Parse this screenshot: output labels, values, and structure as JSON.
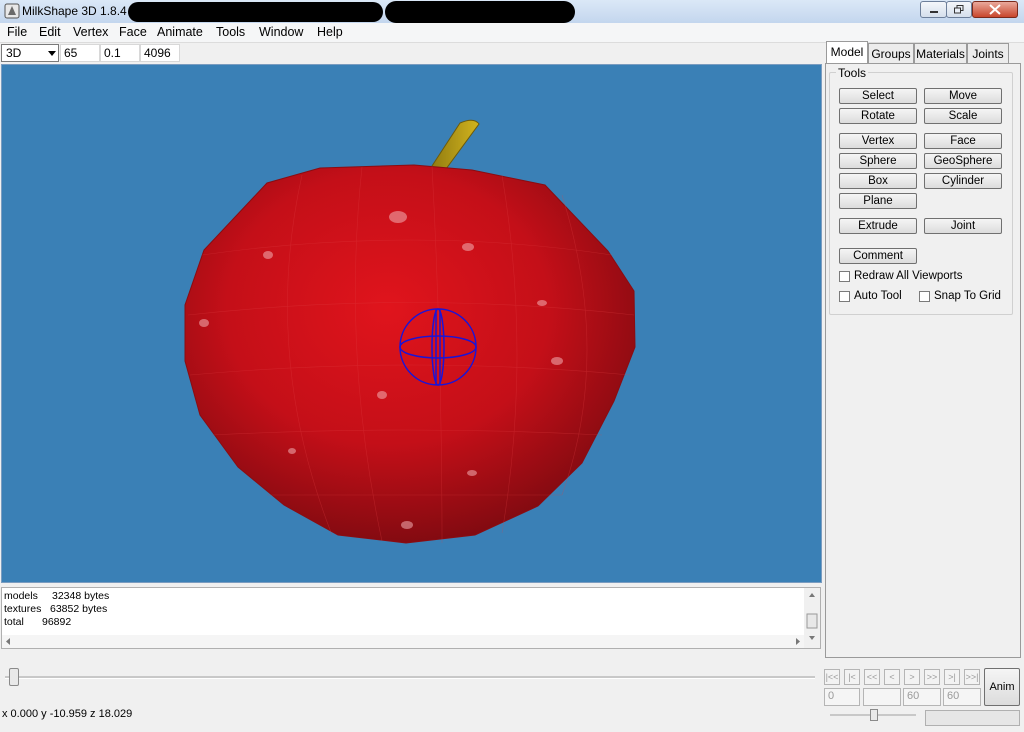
{
  "window": {
    "title": "MilkShape 3D 1.8.4"
  },
  "menu": [
    "File",
    "Edit",
    "Vertex",
    "Face",
    "Animate",
    "Tools",
    "Window",
    "Help"
  ],
  "toolbar": {
    "view_mode": "3D",
    "field1": "65",
    "field2": "0.1",
    "field3": "4096"
  },
  "log": {
    "lines": [
      {
        "label": "models",
        "value": "32348 bytes"
      },
      {
        "label": "textures",
        "value": "63852 bytes"
      },
      {
        "label": "total",
        "value": "96892"
      }
    ]
  },
  "status": {
    "coords": "x 0.000 y -10.959 z 18.029"
  },
  "tabs": [
    "Model",
    "Groups",
    "Materials",
    "Joints"
  ],
  "tools": {
    "group_label": "Tools",
    "buttons": [
      "Select",
      "Move",
      "Rotate",
      "Scale",
      "Vertex",
      "Face",
      "Sphere",
      "GeoSphere",
      "Box",
      "Cylinder",
      "Plane",
      "Extrude",
      "Joint",
      "Comment"
    ],
    "checkboxes": [
      "Redraw All Viewports",
      "Auto Tool",
      "Snap To Grid"
    ]
  },
  "animation": {
    "buttons": [
      "|<<",
      "|<",
      "<<",
      "<",
      ">",
      ">>",
      ">|",
      ">>|"
    ],
    "frame": "0",
    "blank": "",
    "start": "60",
    "end": "60",
    "anim_label": "Anim"
  },
  "colors": {
    "viewport_bg": "#3a80b6",
    "apple": "#c8121a",
    "sphere": "#1a14d8"
  }
}
